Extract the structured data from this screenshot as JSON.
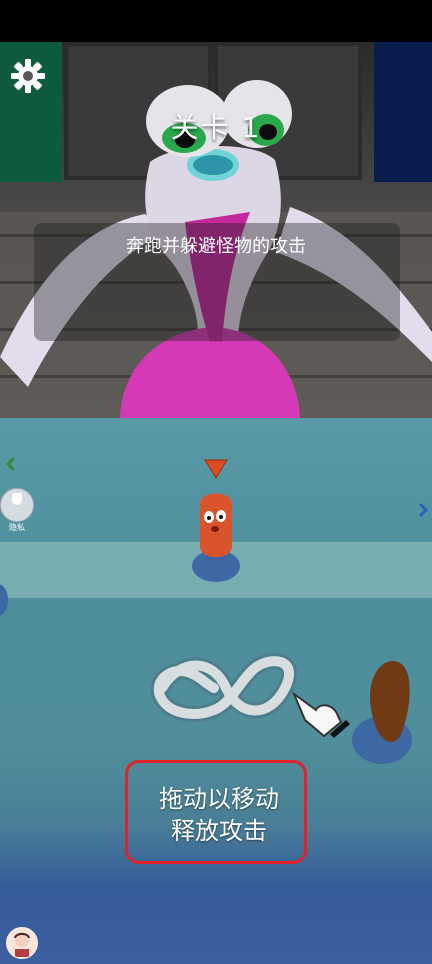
{
  "hud": {
    "level_title": "关卡 1",
    "objective": "奔跑并躲避怪物的攻击"
  },
  "privacy_badge": {
    "label": "隐私"
  },
  "instructions": {
    "line1": "拖动以移动",
    "line2": "释放攻击"
  },
  "icons": {
    "settings": "gear-icon",
    "left_nav": "chevron-left-icon",
    "right_nav": "chevron-right-icon",
    "player_marker": "triangle-down-icon",
    "gesture": "infinity-path-icon",
    "hand": "hand-pointer-icon",
    "avatar": "user-avatar-icon"
  },
  "colors": {
    "monster_pink": "#d23bb3",
    "monster_white": "#ded7e5",
    "monster_eye": "#2fa84f",
    "player_orange": "#d9542b",
    "marker_orange": "#d84b23",
    "highlight_red": "#e1222b",
    "field_teal": "#4f8f9d"
  }
}
